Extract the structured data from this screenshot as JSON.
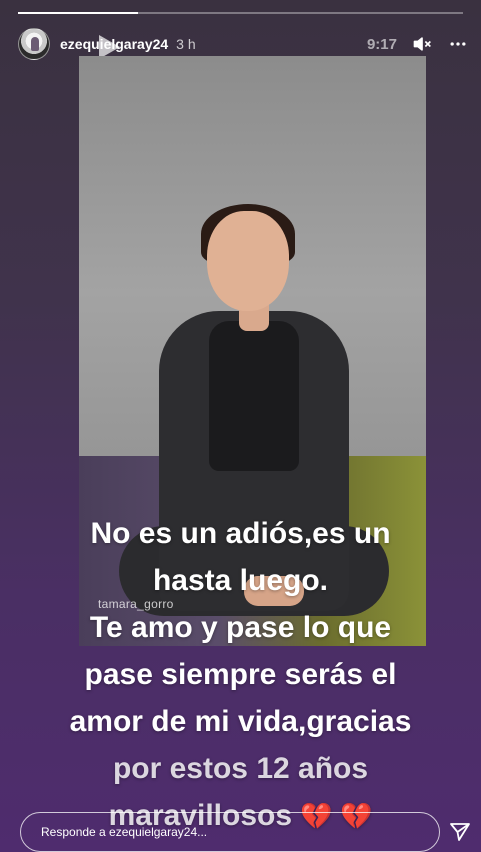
{
  "story": {
    "progress": 0.27,
    "username": "ezequielgaray24",
    "time_ago": "3 h",
    "clock": "9:17",
    "watermark": "tamara_gorro",
    "caption": {
      "line1": "No es un adiós,es un",
      "line2": "hasta luego.",
      "line3": "Te amo y pase lo que",
      "line4": "pase siempre serás el",
      "line5": "amor de mi vida,gracias",
      "line6": "por estos 12 años",
      "line7": "maravillosos",
      "hearts": "💔 💔"
    },
    "reply_placeholder": "Responde a ezequielgaray24..."
  },
  "colors": {
    "accent": "#ffffff",
    "background_top": "#3a3140",
    "background_bottom": "#4f2c6e",
    "heart": "#c4243b"
  },
  "icons": [
    "play-icon",
    "mute-icon",
    "more-icon",
    "send-icon"
  ]
}
